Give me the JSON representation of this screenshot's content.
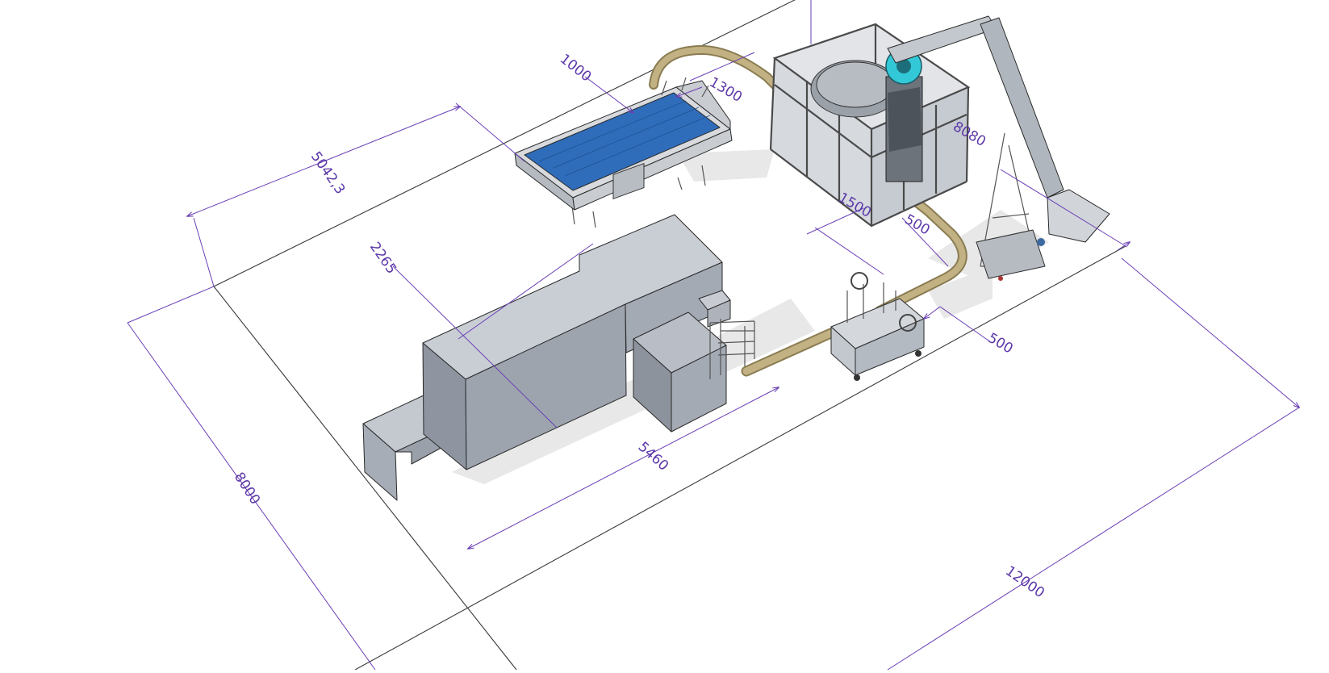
{
  "dimensions": {
    "d5042": "5042,3",
    "d1000": "1000",
    "d1300": "1300",
    "d8080": "8080",
    "d2265": "2265",
    "d1500": "1500",
    "d500a": "500",
    "d500b": "500",
    "d5460": "5460",
    "d8000": "8000",
    "d12000": "12000"
  },
  "colors": {
    "dimension": "#6a3fb5",
    "conveyor_belt": "#2f6dbb",
    "transfer_track": "#b9a77a",
    "enclosure": "#a9afb8",
    "highlight_part": "#33c8d8"
  }
}
